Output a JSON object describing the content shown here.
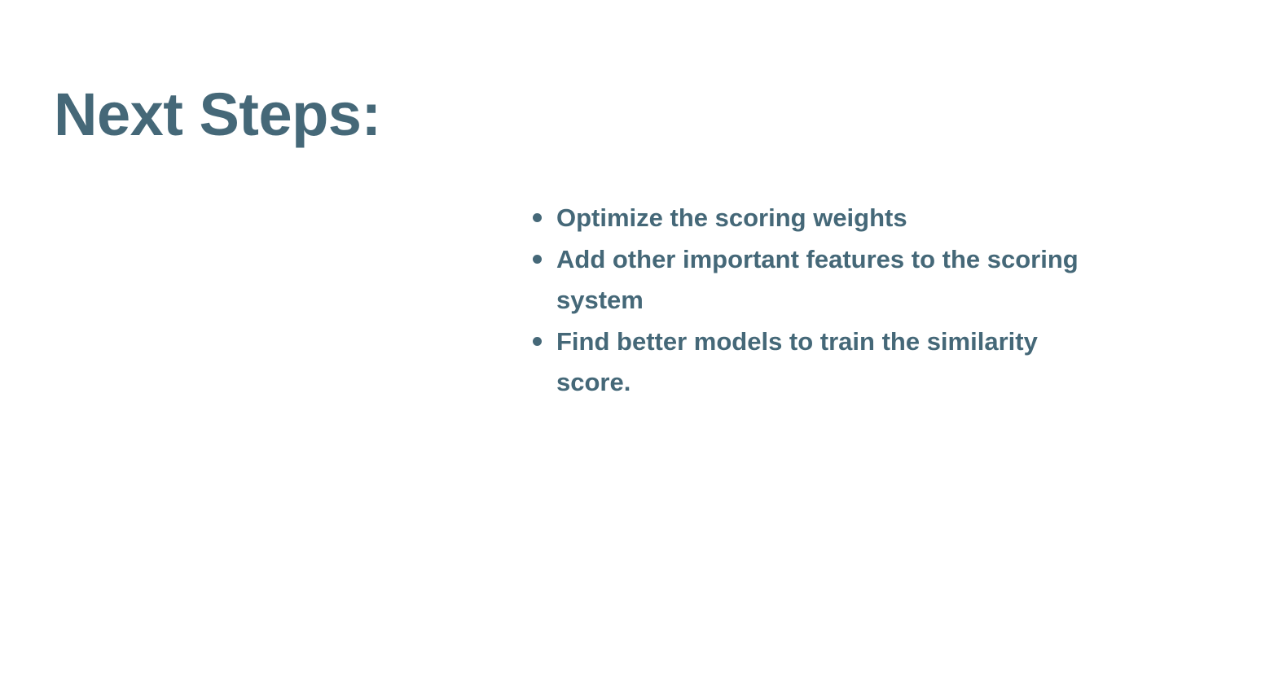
{
  "slide": {
    "title": "Next Steps:",
    "bullets": [
      "Optimize the scoring weights",
      "Add other important features to the scoring system",
      "Find better models to train the similarity score."
    ]
  },
  "colors": {
    "text": "#456878",
    "background": "#ffffff"
  }
}
